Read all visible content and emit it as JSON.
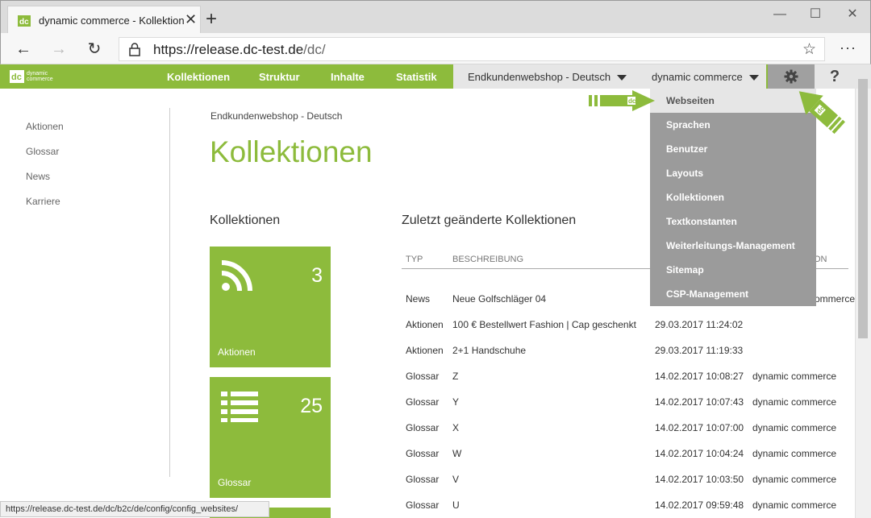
{
  "browser": {
    "tab_title": "dynamic commerce - Kollektionen",
    "new_tab_glyph": "+",
    "url_host": "https://release.dc-test.de",
    "url_path": "/dc/",
    "status_url": "https://release.dc-test.de/dc/b2c/de/config/config_websites/"
  },
  "app": {
    "logo_text_line1": "dynamic",
    "logo_text_line2": "commerce",
    "nav": [
      "Kollektionen",
      "Struktur",
      "Inhalte",
      "Statistik"
    ],
    "shop_dropdown": "Endkundenwebshop - Deutsch",
    "user_dropdown": "dynamic commerce",
    "help_label": "?",
    "accent_color": "#8dbb3c"
  },
  "sidebar": {
    "items": [
      "Aktionen",
      "Glossar",
      "News",
      "Karriere"
    ]
  },
  "page": {
    "breadcrumb": "Endkundenwebshop - Deutsch",
    "title": "Kollektionen",
    "collections_heading": "Kollektionen",
    "recent_heading": "Zuletzt geänderte Kollektionen"
  },
  "tiles": [
    {
      "label": "Aktionen",
      "count": "3",
      "icon": "rss-icon"
    },
    {
      "label": "Glossar",
      "count": "25",
      "icon": "list-icon"
    }
  ],
  "table": {
    "headers": [
      "TYP",
      "BESCHREIBUNG",
      "ON"
    ],
    "rows": [
      {
        "type": "News",
        "description": "Neue Golfschläger 04",
        "date": "",
        "user": "ommerce"
      },
      {
        "type": "Aktionen",
        "description": "100 € Bestellwert Fashion | Cap geschenkt",
        "date": "29.03.2017 11:24:02",
        "user": ""
      },
      {
        "type": "Aktionen",
        "description": "2+1 Handschuhe",
        "date": "29.03.2017 11:19:33",
        "user": ""
      },
      {
        "type": "Glossar",
        "description": "Z",
        "date": "14.02.2017 10:08:27",
        "user": "dynamic commerce"
      },
      {
        "type": "Glossar",
        "description": "Y",
        "date": "14.02.2017 10:07:43",
        "user": "dynamic commerce"
      },
      {
        "type": "Glossar",
        "description": "X",
        "date": "14.02.2017 10:07:00",
        "user": "dynamic commerce"
      },
      {
        "type": "Glossar",
        "description": "W",
        "date": "14.02.2017 10:04:24",
        "user": "dynamic commerce"
      },
      {
        "type": "Glossar",
        "description": "V",
        "date": "14.02.2017 10:03:50",
        "user": "dynamic commerce"
      },
      {
        "type": "Glossar",
        "description": "U",
        "date": "14.02.2017 09:59:48",
        "user": "dynamic commerce"
      }
    ]
  },
  "settings_menu": {
    "items": [
      "Webseiten",
      "Sprachen",
      "Benutzer",
      "Layouts",
      "Kollektionen",
      "Textkonstanten",
      "Weiterleitungs-Management",
      "Sitemap",
      "CSP-Management"
    ],
    "active_index": 0
  }
}
